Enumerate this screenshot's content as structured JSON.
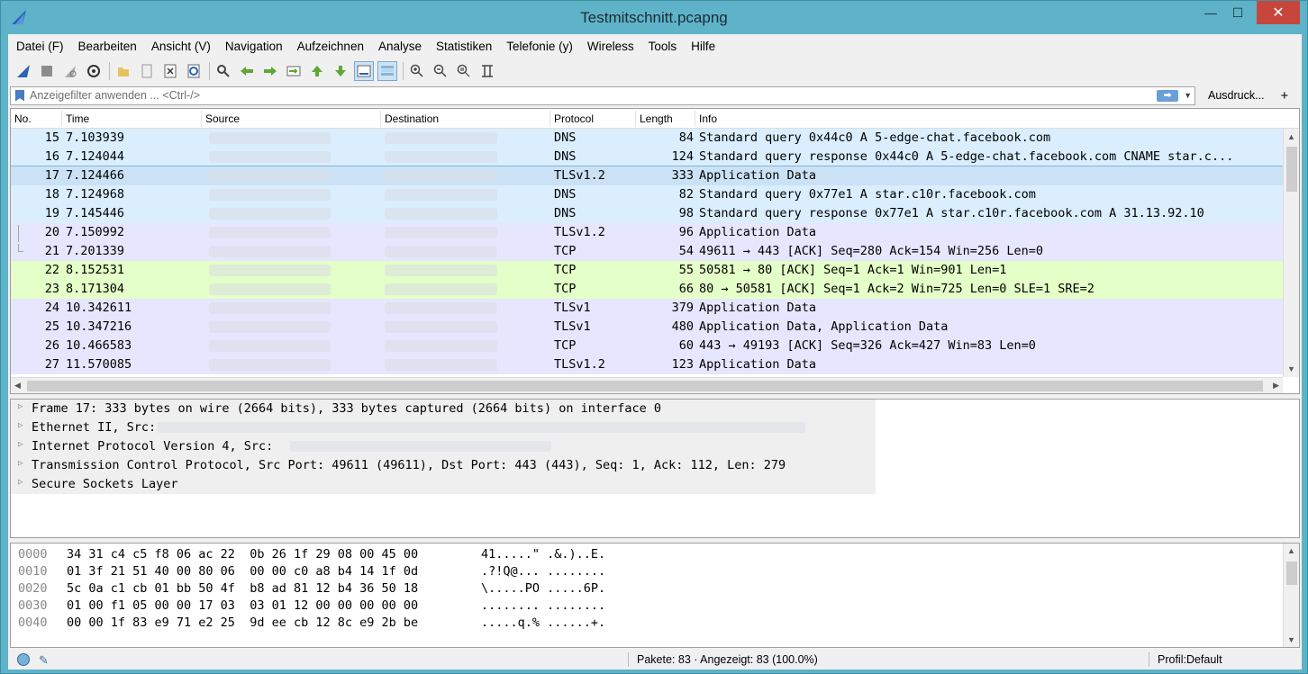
{
  "window": {
    "title": "Testmitschnitt.pcapng",
    "min": "—",
    "max": "☐",
    "close": "✕"
  },
  "menu": [
    "Datei (F)",
    "Bearbeiten",
    "Ansicht (V)",
    "Navigation",
    "Aufzeichnen",
    "Analyse",
    "Statistiken",
    "Telefonie (y)",
    "Wireless",
    "Tools",
    "Hilfe"
  ],
  "filter": {
    "placeholder": "Anzeigefilter anwenden ... <Ctrl-/>",
    "expression_label": "Ausdruck...",
    "add_label": "+"
  },
  "packet_list": {
    "columns": [
      "No.",
      "Time",
      "Source",
      "Destination",
      "Protocol",
      "Length",
      "Info"
    ],
    "rows": [
      {
        "no": "15",
        "time": "7.103939",
        "protocol": "DNS",
        "length": "84",
        "info": "Standard query 0x44c0 A 5-edge-chat.facebook.com"
      },
      {
        "no": "16",
        "time": "7.124044",
        "protocol": "DNS",
        "length": "124",
        "info": "Standard query response 0x44c0 A 5-edge-chat.facebook.com CNAME star.c..."
      },
      {
        "no": "17",
        "time": "7.124466",
        "protocol": "TLSv1.2",
        "length": "333",
        "info": "Application Data"
      },
      {
        "no": "18",
        "time": "7.124968",
        "protocol": "DNS",
        "length": "82",
        "info": "Standard query 0x77e1 A star.c10r.facebook.com"
      },
      {
        "no": "19",
        "time": "7.145446",
        "protocol": "DNS",
        "length": "98",
        "info": "Standard query response 0x77e1 A star.c10r.facebook.com A 31.13.92.10"
      },
      {
        "no": "20",
        "time": "7.150992",
        "protocol": "TLSv1.2",
        "length": "96",
        "info": "Application Data"
      },
      {
        "no": "21",
        "time": "7.201339",
        "protocol": "TCP",
        "length": "54",
        "info": "49611 → 443 [ACK] Seq=280 Ack=154 Win=256 Len=0"
      },
      {
        "no": "22",
        "time": "8.152531",
        "protocol": "TCP",
        "length": "55",
        "info": "50581 → 80 [ACK] Seq=1 Ack=1 Win=901 Len=1"
      },
      {
        "no": "23",
        "time": "8.171304",
        "protocol": "TCP",
        "length": "66",
        "info": "80 → 50581 [ACK] Seq=1 Ack=2 Win=725 Len=0 SLE=1 SRE=2"
      },
      {
        "no": "24",
        "time": "10.342611",
        "protocol": "TLSv1",
        "length": "379",
        "info": "Application Data"
      },
      {
        "no": "25",
        "time": "10.347216",
        "protocol": "TLSv1",
        "length": "480",
        "info": "Application Data, Application Data"
      },
      {
        "no": "26",
        "time": "10.466583",
        "protocol": "TCP",
        "length": "60",
        "info": "443 → 49193 [ACK] Seq=326 Ack=427 Win=83 Len=0"
      },
      {
        "no": "27",
        "time": "11.570085",
        "protocol": "TLSv1.2",
        "length": "123",
        "info": "Application Data"
      }
    ]
  },
  "details": [
    "Frame 17: 333 bytes on wire (2664 bits), 333 bytes captured (2664 bits) on interface 0",
    "Ethernet II, Src:",
    "Internet Protocol Version 4, Src:",
    "Transmission Control Protocol, Src Port: 49611 (49611), Dst Port: 443 (443), Seq: 1, Ack: 112, Len: 279",
    "Secure Sockets Layer"
  ],
  "hex": [
    {
      "offset": "0000",
      "bytes": "34 31 c4 c5 f8 06 ac 22  0b 26 1f 29 08 00 45 00",
      "ascii": "41.....\" .&.)..E."
    },
    {
      "offset": "0010",
      "bytes": "01 3f 21 51 40 00 80 06  00 00 c0 a8 b4 14 1f 0d",
      "ascii": ".?!Q@... ........"
    },
    {
      "offset": "0020",
      "bytes": "5c 0a c1 cb 01 bb 50 4f  b8 ad 81 12 b4 36 50 18",
      "ascii": "\\.....PO .....6P."
    },
    {
      "offset": "0030",
      "bytes": "01 00 f1 05 00 00 17 03  03 01 12 00 00 00 00 00",
      "ascii": "........ ........"
    },
    {
      "offset": "0040",
      "bytes": "00 00 1f 83 e9 71 e2 25  9d ee cb 12 8c e9 2b be",
      "ascii": ".....q.% ......+."
    }
  ],
  "status": {
    "packets": "Pakete: 83 · Angezeigt: 83 (100.0%)",
    "profile": "Profil:Default"
  }
}
